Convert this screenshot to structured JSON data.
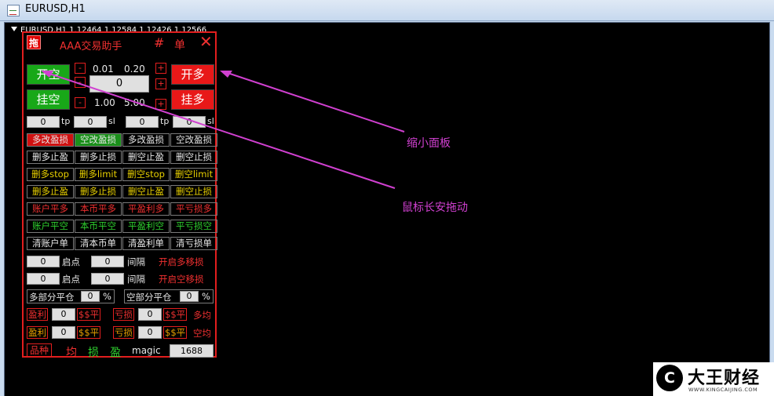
{
  "window": {
    "title": "EURUSD,H1"
  },
  "chart": {
    "header": "EURUSD,H1  1.12464 1.12584 1.12426 1.12566"
  },
  "panel": {
    "drag_label": "拖",
    "title": "AAA交易助手",
    "hash_label": "#",
    "single_label": "单",
    "close_label": "✕",
    "open_short": "开空",
    "pend_short": "挂空",
    "open_long": "开多",
    "pend_long": "挂多",
    "minus": "-",
    "plus": "+",
    "lot_a": "0.01",
    "lot_b": "0.20",
    "lot_c": "1.00",
    "lot_d": "5.00",
    "lot_value": "0",
    "tp_label": "tp",
    "sl_label": "sl",
    "tp1": "0",
    "sl1": "0",
    "tp2": "0",
    "sl2": "0",
    "grid": [
      [
        "多改盈损",
        "空改盈损",
        "多改盈损",
        "空改盈损"
      ],
      [
        "删多止盈",
        "删多止损",
        "删空止盈",
        "删空止损"
      ],
      [
        "删多stop",
        "删多limit",
        "删空stop",
        "删空limit"
      ],
      [
        "删多止盈",
        "删多止损",
        "删空止盈",
        "删空止损"
      ],
      [
        "账户平多",
        "本币平多",
        "平盈利多",
        "平亏损多"
      ],
      [
        "账户平空",
        "本币平空",
        "平盈利空",
        "平亏损空"
      ],
      [
        "清账户单",
        "清本币单",
        "清盈利单",
        "清亏损单"
      ]
    ],
    "trail1": {
      "start": "0",
      "start_label": "启点",
      "gap": "0",
      "gap_label": "间隔",
      "action": "开启多移损"
    },
    "trail2": {
      "start": "0",
      "start_label": "启点",
      "gap": "0",
      "gap_label": "间隔",
      "action": "开启空移损"
    },
    "partial_long": {
      "label": "多部分平仓",
      "value": "0",
      "unit": "%"
    },
    "partial_short": {
      "label": "空部分平仓",
      "value": "0",
      "unit": "%"
    },
    "pl1": {
      "profit": "盈利",
      "pv": "0",
      "pbtn": "$$平",
      "loss": "亏损",
      "lv": "0",
      "lbtn": "$$平",
      "side": "多均"
    },
    "pl2": {
      "profit": "盈利",
      "pv": "0",
      "pbtn": "$$平",
      "loss": "亏损",
      "lv": "0",
      "lbtn": "$$平",
      "side": "空均"
    },
    "bottom": {
      "symbol": "品种",
      "avg": "均",
      "loss": "损",
      "profit": "盈",
      "magic_label": "magic",
      "magic_value": "1688"
    }
  },
  "annotations": {
    "shrink": "缩小面板",
    "drag": "鼠标长安拖动"
  },
  "watermark": {
    "cn": "大王财经",
    "en": "WWW.KINGCAIJING.COM",
    "logo": "C"
  },
  "colors": {
    "panel_border": "#e21e1e",
    "accent_red": "#f03030",
    "green": "#18a818",
    "annotation": "#d040d0"
  }
}
